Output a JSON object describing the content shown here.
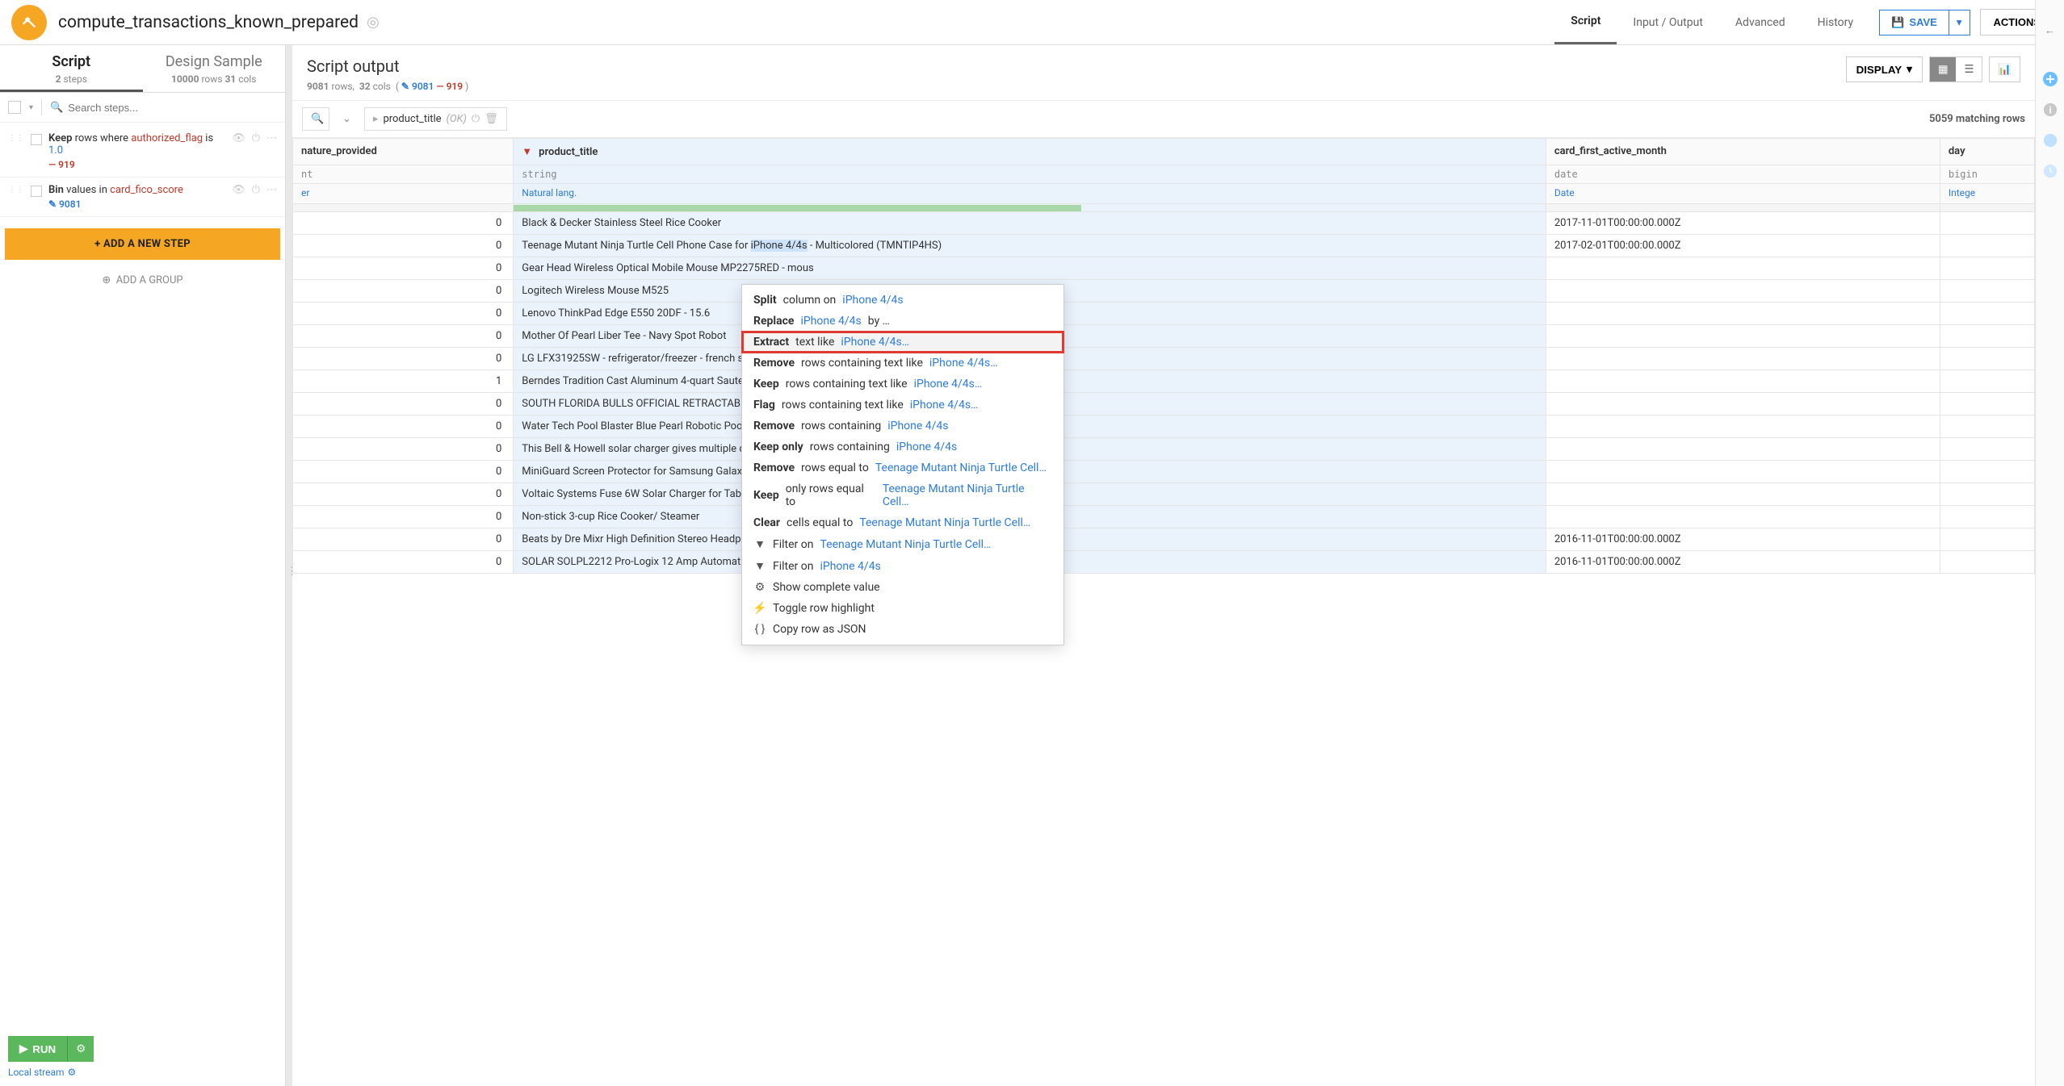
{
  "header": {
    "recipe_title": "compute_transactions_known_prepared",
    "tabs": {
      "script": "Script",
      "io": "Input / Output",
      "advanced": "Advanced",
      "history": "History"
    },
    "save": "SAVE",
    "actions": "ACTIONS"
  },
  "left": {
    "tabs": {
      "script": {
        "title": "Script",
        "sub_count": "2",
        "sub_label": "steps"
      },
      "sample": {
        "title": "Design Sample",
        "sub_rows": "10000",
        "sub_rows_label": "rows",
        "sub_cols": "31",
        "sub_cols_label": "cols"
      }
    },
    "search_placeholder": "Search steps...",
    "steps": [
      {
        "kw": "Keep",
        "mid": "rows where",
        "col": "authorized_flag",
        "post": "is",
        "val": "1.0",
        "delta": "— 919",
        "delta_class": "red"
      },
      {
        "kw": "Bin",
        "mid": "values in",
        "col": "card_fico_score",
        "delta": "✎ 9081",
        "delta_class": "blue"
      }
    ],
    "add_step": "+ ADD A NEW STEP",
    "add_group": "ADD A GROUP",
    "run": "RUN",
    "local_stream": "Local stream"
  },
  "output": {
    "title": "Script output",
    "rows": "9081",
    "rows_label": "rows,",
    "cols": "32",
    "cols_label": "cols",
    "delta_blue": "9081",
    "delta_red": "919",
    "display": "DISPLAY",
    "filter_col": "product_title",
    "filter_ok": "(OK)",
    "matching": "5059 matching rows"
  },
  "table": {
    "cols": [
      {
        "name": "nature_provided",
        "type": "nt",
        "meaning": "er"
      },
      {
        "name": "product_title",
        "type": "string",
        "meaning": "Natural lang.",
        "filtered": true
      },
      {
        "name": "card_first_active_month",
        "type": "date",
        "meaning": "Date"
      },
      {
        "name": "day",
        "type": "bigin",
        "meaning": "Intege"
      }
    ],
    "rows": [
      {
        "n": "0",
        "p": "Black & Decker Stainless Steel Rice Cooker",
        "c": "2017-11-01T00:00:00.000Z"
      },
      {
        "n": "0",
        "p_pre": "Teenage Mutant Ninja Turtle Cell Phone Case for ",
        "p_hl": "iPhone 4/4s",
        "p_post": " - Multicolored (TMNTIP4HS)",
        "c": "2017-02-01T00:00:00.000Z"
      },
      {
        "n": "0",
        "p": "Gear Head Wireless Optical Mobile Mouse MP2275RED - mous"
      },
      {
        "n": "0",
        "p": "Logitech Wireless Mouse M525"
      },
      {
        "n": "0",
        "p": "Lenovo ThinkPad Edge E550 20DF - 15.6"
      },
      {
        "n": "0",
        "p": "Mother Of Pearl Liber Tee - Navy Spot Robot"
      },
      {
        "n": "0",
        "p": "LG LFX31925SW - refrigerator/freezer - french style - freestandi"
      },
      {
        "n": "1",
        "p": "Berndes Tradition Cast Aluminum 4-quart Saute with Glass Lid"
      },
      {
        "n": "0",
        "p": "SOUTH FLORIDA BULLS OFFICIAL RETRACTABLE BADGE HOLD"
      },
      {
        "n": "0",
        "p": "Water Tech Pool Blaster Blue Pearl Robotic Pool Cleaner"
      },
      {
        "n": "0",
        "p": "This Bell & Howell solar charger gives multiple devices instant"
      },
      {
        "n": "0",
        "p": "MiniGuard Screen Protector for Samsung Galaxy Tab 3 7.0"
      },
      {
        "n": "0",
        "p": "Voltaic Systems Fuse 6W Solar Charger for Tablets and Handhe"
      },
      {
        "n": "0",
        "p": "Non-stick 3-cup Rice Cooker/ Steamer"
      },
      {
        "n": "0",
        "p": "Beats by Dre Mixr High Definition Stereo Headphones w/Control - Neon Green",
        "c": "2016-11-01T00:00:00.000Z"
      },
      {
        "n": "0",
        "p": "SOLAR SOLPL2212 Pro-Logix 12 Amp Automatic Battery Charger",
        "c": "2016-11-01T00:00:00.000Z"
      }
    ]
  },
  "ctx": {
    "token": "iPhone 4/4s",
    "full": "Teenage Mutant Ninja Turtle Cell…",
    "items": [
      {
        "kw": "Split",
        "t1": "column on",
        "lk": "iPhone 4/4s"
      },
      {
        "kw": "Replace",
        "lk": "iPhone 4/4s",
        "t2": "by …"
      },
      {
        "kw": "Extract",
        "t1": "text like",
        "lk": "iPhone 4/4s…",
        "hl": true
      },
      {
        "kw": "Remove",
        "t1": "rows containing text like",
        "lk": "iPhone 4/4s…"
      },
      {
        "kw": "Keep",
        "t1": "rows containing text like",
        "lk": "iPhone 4/4s…"
      },
      {
        "kw": "Flag",
        "t1": "rows containing text like",
        "lk": "iPhone 4/4s…"
      },
      {
        "kw": "Remove",
        "t1": "rows containing",
        "lk": "iPhone 4/4s"
      },
      {
        "kw": "Keep only",
        "t1": "rows containing",
        "lk": "iPhone 4/4s"
      },
      {
        "kw": "Remove",
        "t1": "rows equal to",
        "lk": "Teenage Mutant Ninja Turtle Cell…"
      },
      {
        "kw": "Keep",
        "t1": "only rows equal to",
        "lk": "Teenage Mutant Ninja Turtle Cell…"
      },
      {
        "kw": "Clear",
        "t1": "cells equal to",
        "lk": "Teenage Mutant Ninja Turtle Cell…"
      },
      {
        "icon": "filter",
        "t1": "Filter on",
        "lk": "Teenage Mutant Ninja Turtle Cell…"
      },
      {
        "icon": "filter",
        "t1": "Filter on",
        "lk": "iPhone 4/4s"
      },
      {
        "icon": "gear",
        "t1": "Show complete value"
      },
      {
        "icon": "bolt",
        "t1": "Toggle row highlight"
      },
      {
        "icon": "braces",
        "t1": "Copy row as JSON"
      }
    ]
  }
}
